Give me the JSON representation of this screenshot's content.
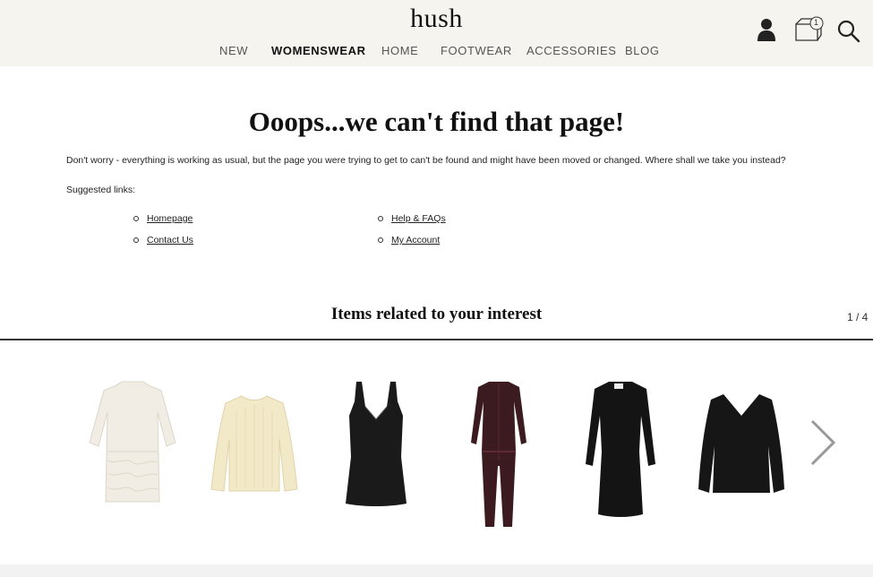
{
  "header": {
    "logo": "hush",
    "nav": [
      "NEW",
      "WOMENSWEAR",
      "HOME",
      "FOOTWEAR",
      "ACCESSORIES",
      "BLOG"
    ],
    "active_nav": "WOMENSWEAR",
    "cart_count": "1",
    "icons": [
      "account-icon",
      "cart-icon",
      "search-icon"
    ]
  },
  "error": {
    "title": "Ooops...we can't find that page!",
    "description": "Don't worry - everything is working as usual, but the page you were trying to get to can't be found and might have been moved or changed. Where shall we take you instead?",
    "suggested_label": "Suggested links:",
    "links": [
      "Homepage",
      "Contact Us",
      "Help & FAQs",
      "My Account"
    ]
  },
  "related": {
    "heading": "Items related to your interest",
    "pager": "1 / 4",
    "products": [
      {
        "name": "cream-lace-dress",
        "color": "#f1ede4"
      },
      {
        "name": "cream-knit-jumper",
        "color": "#f2e9c9"
      },
      {
        "name": "black-v-dress",
        "color": "#1a1a1a"
      },
      {
        "name": "burgundy-jumpsuit",
        "color": "#3b1a20"
      },
      {
        "name": "black-long-sleeve-dress",
        "color": "#141414"
      },
      {
        "name": "black-v-neck-jumper",
        "color": "#161616"
      }
    ]
  },
  "colors": {
    "header_bg": "#f6f4ee",
    "text": "#222222",
    "rule": "#333333"
  }
}
